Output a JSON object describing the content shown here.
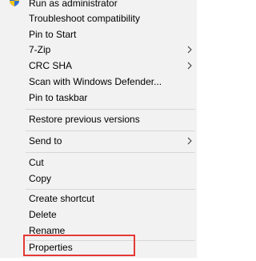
{
  "menu": {
    "items": [
      {
        "label": "Run as administrator"
      },
      {
        "label": "Troubleshoot compatibility"
      },
      {
        "label": "Pin to Start"
      },
      {
        "label": "7-Zip"
      },
      {
        "label": "CRC SHA"
      },
      {
        "label": "Scan with Windows Defender..."
      },
      {
        "label": "Pin to taskbar"
      },
      {
        "label": "Restore previous versions"
      },
      {
        "label": "Send to"
      },
      {
        "label": "Cut"
      },
      {
        "label": "Copy"
      },
      {
        "label": "Create shortcut"
      },
      {
        "label": "Delete"
      },
      {
        "label": "Rename"
      },
      {
        "label": "Properties"
      }
    ]
  },
  "colors": {
    "menu_background": "#f2f2f2",
    "separator": "#d7d7d7",
    "highlight_box": "#e53935",
    "text": "#000000"
  },
  "icons": {
    "run_as_admin": "uac-shield-icon",
    "submenu": "chevron-right-icon"
  }
}
